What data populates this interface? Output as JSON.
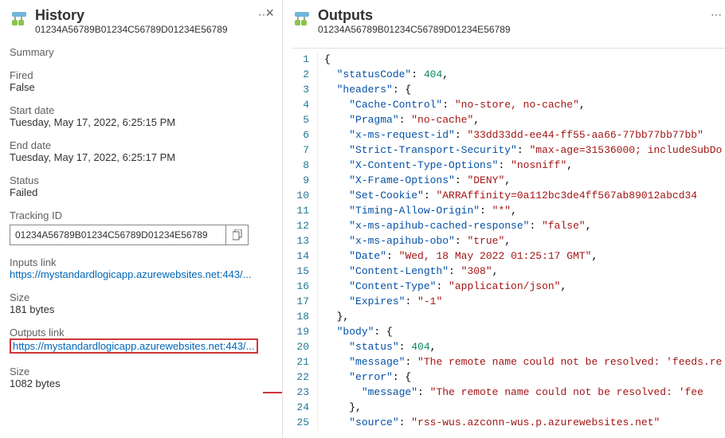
{
  "history": {
    "title": "History",
    "guid": "01234A56789B01234C56789D01234E56789",
    "summary_label": "Summary",
    "fired_label": "Fired",
    "fired_value": "False",
    "start_label": "Start date",
    "start_value": "Tuesday, May 17, 2022, 6:25:15 PM",
    "end_label": "End date",
    "end_value": "Tuesday, May 17, 2022, 6:25:17 PM",
    "status_label": "Status",
    "status_value": "Failed",
    "tracking_label": "Tracking ID",
    "tracking_value": "01234A56789B01234C56789D01234E56789",
    "inputs_link_label": "Inputs link",
    "inputs_link_url": "https://mystandardlogicapp.azurewebsites.net:443/...",
    "inputs_size_label": "Size",
    "inputs_size_value": "181 bytes",
    "outputs_link_label": "Outputs link",
    "outputs_link_url": "https://mystandardlogicapp.azurewebsites.net:443/...",
    "outputs_size_label": "Size",
    "outputs_size_value": "1082 bytes"
  },
  "outputs": {
    "title": "Outputs",
    "guid": "01234A56789B01234C56789D01234E56789",
    "json_lines": [
      [
        [
          "punc",
          "{"
        ]
      ],
      [
        [
          "sp",
          "  "
        ],
        [
          "key",
          "\"statusCode\""
        ],
        [
          "punc",
          ": "
        ],
        [
          "num",
          "404"
        ],
        [
          "punc",
          ","
        ]
      ],
      [
        [
          "sp",
          "  "
        ],
        [
          "key",
          "\"headers\""
        ],
        [
          "punc",
          ": {"
        ]
      ],
      [
        [
          "sp",
          "    "
        ],
        [
          "key",
          "\"Cache-Control\""
        ],
        [
          "punc",
          ": "
        ],
        [
          "str",
          "\"no-store, no-cache\""
        ],
        [
          "punc",
          ","
        ]
      ],
      [
        [
          "sp",
          "    "
        ],
        [
          "key",
          "\"Pragma\""
        ],
        [
          "punc",
          ": "
        ],
        [
          "str",
          "\"no-cache\""
        ],
        [
          "punc",
          ","
        ]
      ],
      [
        [
          "sp",
          "    "
        ],
        [
          "key",
          "\"x-ms-request-id\""
        ],
        [
          "punc",
          ": "
        ],
        [
          "str",
          "\"33dd33dd-ee44-ff55-aa66-77bb77bb77bb\""
        ]
      ],
      [
        [
          "sp",
          "    "
        ],
        [
          "key",
          "\"Strict-Transport-Security\""
        ],
        [
          "punc",
          ": "
        ],
        [
          "str",
          "\"max-age=31536000; includeSubDo"
        ]
      ],
      [
        [
          "sp",
          "    "
        ],
        [
          "key",
          "\"X-Content-Type-Options\""
        ],
        [
          "punc",
          ": "
        ],
        [
          "str",
          "\"nosniff\""
        ],
        [
          "punc",
          ","
        ]
      ],
      [
        [
          "sp",
          "    "
        ],
        [
          "key",
          "\"X-Frame-Options\""
        ],
        [
          "punc",
          ": "
        ],
        [
          "str",
          "\"DENY\""
        ],
        [
          "punc",
          ","
        ]
      ],
      [
        [
          "sp",
          "    "
        ],
        [
          "key",
          "\"Set-Cookie\""
        ],
        [
          "punc",
          ": "
        ],
        [
          "str",
          "\"ARRAffinity=0a112bc3de4ff567ab89012abcd34"
        ]
      ],
      [
        [
          "sp",
          "    "
        ],
        [
          "key",
          "\"Timing-Allow-Origin\""
        ],
        [
          "punc",
          ": "
        ],
        [
          "str",
          "\"*\""
        ],
        [
          "punc",
          ","
        ]
      ],
      [
        [
          "sp",
          "    "
        ],
        [
          "key",
          "\"x-ms-apihub-cached-response\""
        ],
        [
          "punc",
          ": "
        ],
        [
          "str",
          "\"false\""
        ],
        [
          "punc",
          ","
        ]
      ],
      [
        [
          "sp",
          "    "
        ],
        [
          "key",
          "\"x-ms-apihub-obo\""
        ],
        [
          "punc",
          ": "
        ],
        [
          "str",
          "\"true\""
        ],
        [
          "punc",
          ","
        ]
      ],
      [
        [
          "sp",
          "    "
        ],
        [
          "key",
          "\"Date\""
        ],
        [
          "punc",
          ": "
        ],
        [
          "str",
          "\"Wed, 18 May 2022 01:25:17 GMT\""
        ],
        [
          "punc",
          ","
        ]
      ],
      [
        [
          "sp",
          "    "
        ],
        [
          "key",
          "\"Content-Length\""
        ],
        [
          "punc",
          ": "
        ],
        [
          "str",
          "\"308\""
        ],
        [
          "punc",
          ","
        ]
      ],
      [
        [
          "sp",
          "    "
        ],
        [
          "key",
          "\"Content-Type\""
        ],
        [
          "punc",
          ": "
        ],
        [
          "str",
          "\"application/json\""
        ],
        [
          "punc",
          ","
        ]
      ],
      [
        [
          "sp",
          "    "
        ],
        [
          "key",
          "\"Expires\""
        ],
        [
          "punc",
          ": "
        ],
        [
          "str",
          "\"-1\""
        ]
      ],
      [
        [
          "sp",
          "  "
        ],
        [
          "punc",
          "},"
        ]
      ],
      [
        [
          "sp",
          "  "
        ],
        [
          "key",
          "\"body\""
        ],
        [
          "punc",
          ": {"
        ]
      ],
      [
        [
          "sp",
          "    "
        ],
        [
          "key",
          "\"status\""
        ],
        [
          "punc",
          ": "
        ],
        [
          "num",
          "404"
        ],
        [
          "punc",
          ","
        ]
      ],
      [
        [
          "sp",
          "    "
        ],
        [
          "key",
          "\"message\""
        ],
        [
          "punc",
          ": "
        ],
        [
          "str",
          "\"The remote name could not be resolved: 'feeds.re"
        ]
      ],
      [
        [
          "sp",
          "    "
        ],
        [
          "key",
          "\"error\""
        ],
        [
          "punc",
          ": {"
        ]
      ],
      [
        [
          "sp",
          "      "
        ],
        [
          "key",
          "\"message\""
        ],
        [
          "punc",
          ": "
        ],
        [
          "str",
          "\"The remote name could not be resolved: 'fee"
        ]
      ],
      [
        [
          "sp",
          "    "
        ],
        [
          "punc",
          "},"
        ]
      ],
      [
        [
          "sp",
          "    "
        ],
        [
          "key",
          "\"source\""
        ],
        [
          "punc",
          ": "
        ],
        [
          "str",
          "\"rss-wus.azconn-wus.p.azurewebsites.net\""
        ]
      ]
    ]
  }
}
